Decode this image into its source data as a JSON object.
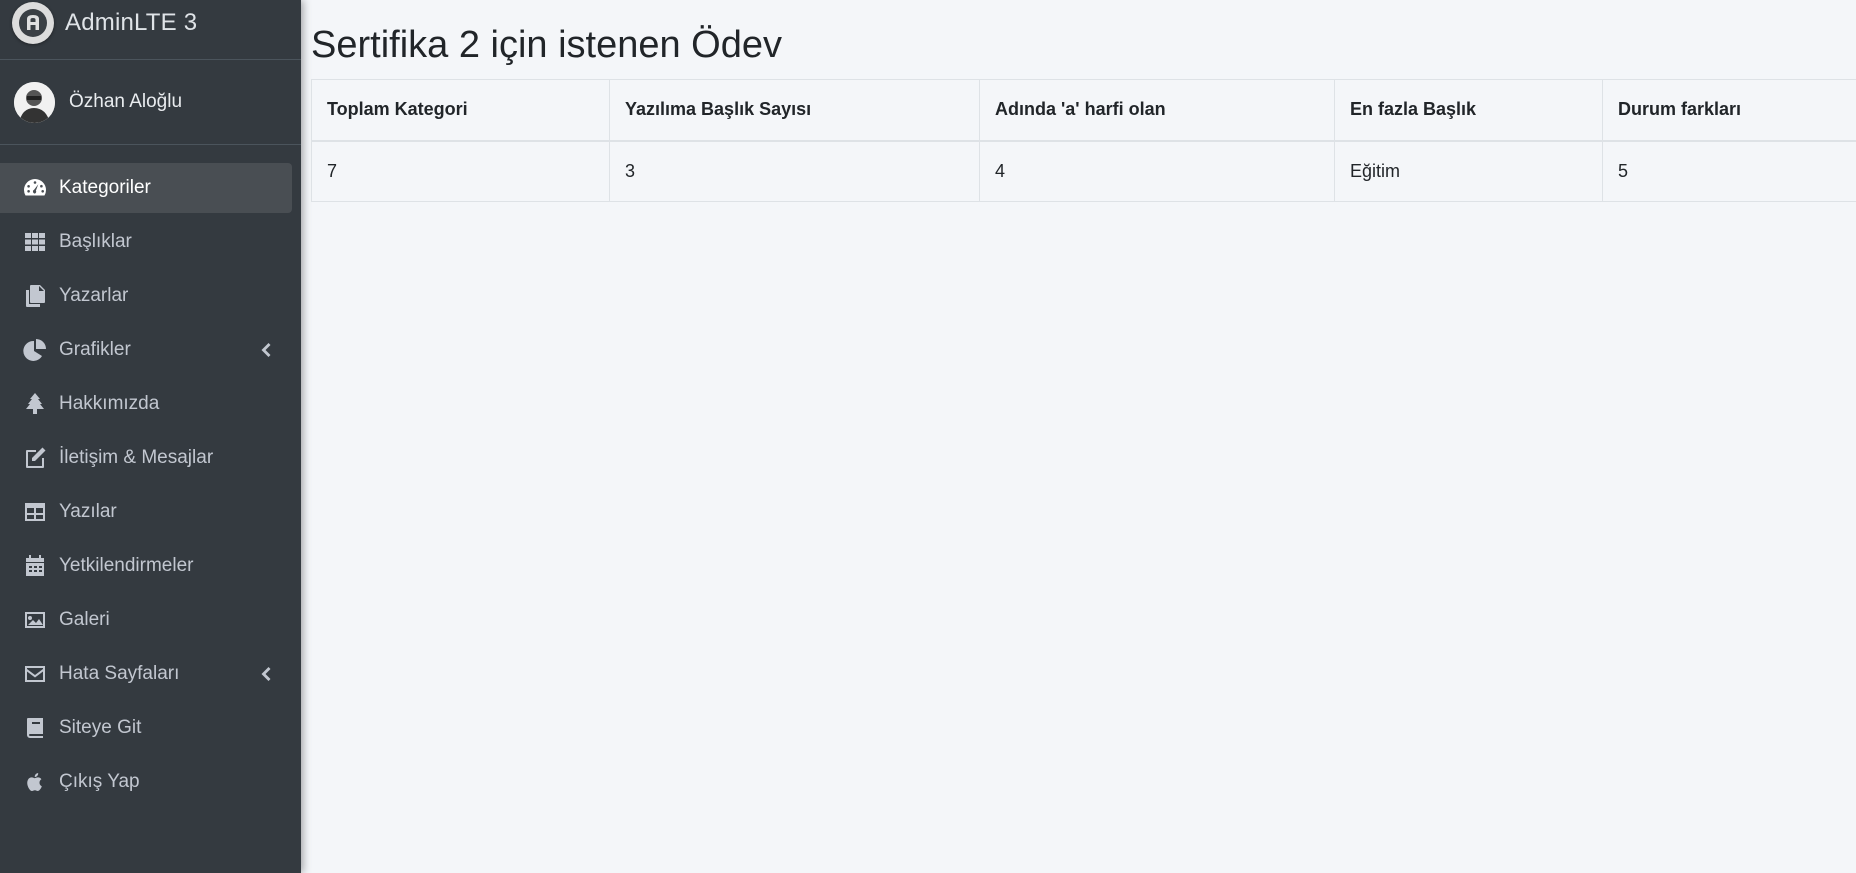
{
  "brand": {
    "title": "AdminLTE 3",
    "icon": "adminlte-logo-icon"
  },
  "user": {
    "name": "Özhan Aloğlu"
  },
  "sidebar": {
    "items": [
      {
        "label": "Kategoriler",
        "icon": "tachometer-icon",
        "active": true
      },
      {
        "label": "Başlıklar",
        "icon": "grid-icon"
      },
      {
        "label": "Yazarlar",
        "icon": "copy-icon"
      },
      {
        "label": "Grafikler",
        "icon": "pie-chart-icon",
        "has_submenu": true
      },
      {
        "label": "Hakkımızda",
        "icon": "tree-icon"
      },
      {
        "label": "İletişim & Mesajlar",
        "icon": "edit-icon"
      },
      {
        "label": "Yazılar",
        "icon": "table-icon"
      },
      {
        "label": "Yetkilendirmeler",
        "icon": "calendar-icon"
      },
      {
        "label": "Galeri",
        "icon": "image-icon"
      },
      {
        "label": "Hata Sayfaları",
        "icon": "envelope-icon",
        "has_submenu": true
      },
      {
        "label": "Siteye Git",
        "icon": "book-icon"
      },
      {
        "label": "Çıkış Yap",
        "icon": "apple-icon"
      }
    ]
  },
  "main": {
    "title": "Sertifika 2 için istenen Ödev",
    "table": {
      "headers": [
        "Toplam Kategori",
        "Yazılıma Başlık Sayısı",
        "Adında 'a' harfi olan",
        "En fazla Başlık",
        "Durum farkları"
      ],
      "rows": [
        [
          "7",
          "3",
          "4",
          "Eğitim",
          "5"
        ]
      ]
    }
  },
  "colors": {
    "sidebar_bg": "#343a40",
    "active_item_bg": "#494e53",
    "content_bg": "#f4f6f9"
  }
}
